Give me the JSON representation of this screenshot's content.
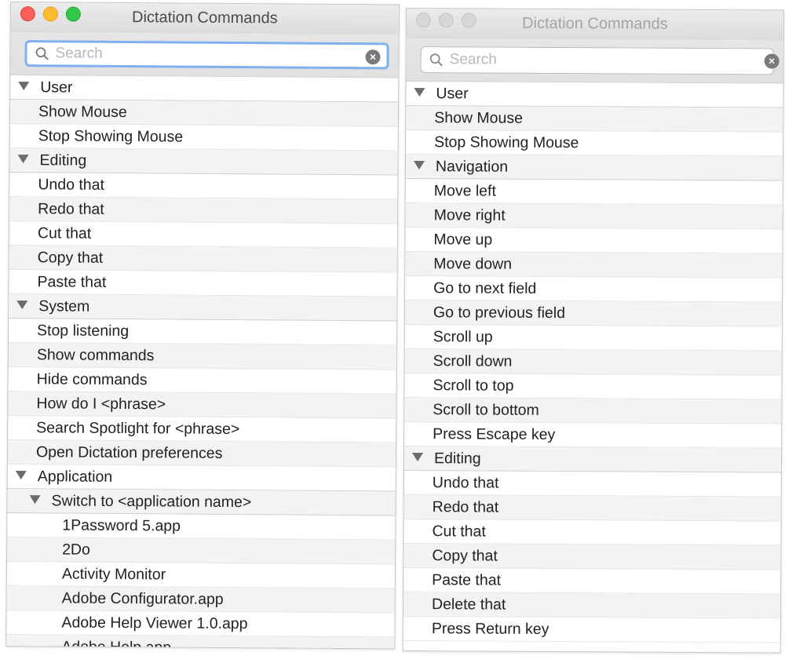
{
  "left_window": {
    "title": "Dictation Commands",
    "search_placeholder": "Search",
    "rows": [
      {
        "text": "User",
        "level": "group"
      },
      {
        "text": "Show Mouse",
        "level": "item"
      },
      {
        "text": "Stop Showing Mouse",
        "level": "item"
      },
      {
        "text": "Editing",
        "level": "group"
      },
      {
        "text": "Undo that",
        "level": "item"
      },
      {
        "text": "Redo that",
        "level": "item"
      },
      {
        "text": "Cut that",
        "level": "item"
      },
      {
        "text": "Copy that",
        "level": "item"
      },
      {
        "text": "Paste that",
        "level": "item"
      },
      {
        "text": "System",
        "level": "group"
      },
      {
        "text": "Stop listening",
        "level": "item"
      },
      {
        "text": "Show commands",
        "level": "item"
      },
      {
        "text": "Hide commands",
        "level": "item"
      },
      {
        "text": "How do I <phrase>",
        "level": "item"
      },
      {
        "text": "Search Spotlight for <phrase>",
        "level": "item"
      },
      {
        "text": "Open Dictation preferences",
        "level": "item"
      },
      {
        "text": "Application",
        "level": "group"
      },
      {
        "text": "Switch to <application name>",
        "level": "subgroup"
      },
      {
        "text": "1Password 5.app",
        "level": "subitem"
      },
      {
        "text": "2Do",
        "level": "subitem"
      },
      {
        "text": "Activity Monitor",
        "level": "subitem"
      },
      {
        "text": "Adobe Configurator.app",
        "level": "subitem"
      },
      {
        "text": "Adobe Help Viewer 1.0.app",
        "level": "subitem"
      },
      {
        "text": "Adobe Help.app",
        "level": "subitem"
      }
    ]
  },
  "right_window": {
    "title": "Dictation Commands",
    "search_placeholder": "Search",
    "rows": [
      {
        "text": "User",
        "level": "group"
      },
      {
        "text": "Show Mouse",
        "level": "item"
      },
      {
        "text": "Stop Showing Mouse",
        "level": "item"
      },
      {
        "text": "Navigation",
        "level": "group"
      },
      {
        "text": "Move left",
        "level": "item"
      },
      {
        "text": "Move right",
        "level": "item"
      },
      {
        "text": "Move up",
        "level": "item"
      },
      {
        "text": "Move down",
        "level": "item"
      },
      {
        "text": "Go to next field",
        "level": "item"
      },
      {
        "text": "Go to previous field",
        "level": "item"
      },
      {
        "text": "Scroll up",
        "level": "item"
      },
      {
        "text": "Scroll down",
        "level": "item"
      },
      {
        "text": "Scroll to top",
        "level": "item"
      },
      {
        "text": "Scroll to bottom",
        "level": "item"
      },
      {
        "text": "Press Escape key",
        "level": "item"
      },
      {
        "text": "Editing",
        "level": "group"
      },
      {
        "text": "Undo that",
        "level": "item"
      },
      {
        "text": "Redo that",
        "level": "item"
      },
      {
        "text": "Cut that",
        "level": "item"
      },
      {
        "text": "Copy that",
        "level": "item"
      },
      {
        "text": "Paste that",
        "level": "item"
      },
      {
        "text": "Delete that",
        "level": "item"
      },
      {
        "text": "Press Return key",
        "level": "item"
      }
    ]
  },
  "icons": {
    "search": "search-icon",
    "clear": "clear-search-icon",
    "disclosure": "disclosure-triangle-icon"
  },
  "colors": {
    "close_light": "#fc5f57",
    "minimize_light": "#fdbc2e",
    "zoom_light": "#34c84a",
    "focus_ring": "#7eb1ee"
  }
}
